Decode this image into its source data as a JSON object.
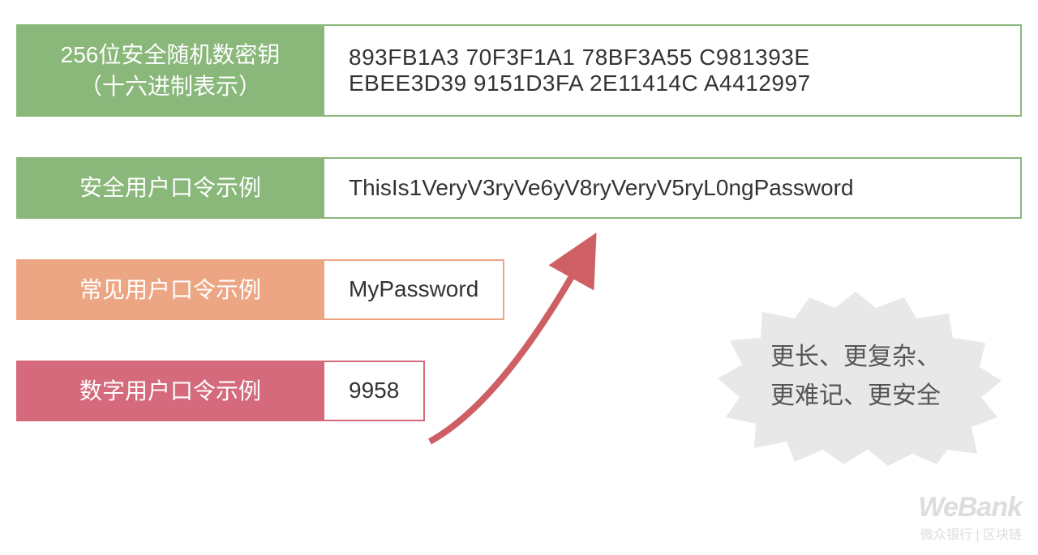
{
  "rows": [
    {
      "label_line1": "256位安全随机数密钥",
      "label_line2": "（十六进制表示）",
      "value_line1": "893FB1A3 70F3F1A1 78BF3A55 C981393E",
      "value_line2": "EBEE3D39 9151D3FA 2E11414C A4412997",
      "color": "green"
    },
    {
      "label": "安全用户口令示例",
      "value": "ThisIs1VeryV3ryVe6yV8ryVeryV5ryL0ngPassword",
      "color": "green"
    },
    {
      "label": "常见用户口令示例",
      "value": "MyPassword",
      "color": "orange"
    },
    {
      "label": "数字用户口令示例",
      "value": "9958",
      "color": "red"
    }
  ],
  "callout": {
    "line1": "更长、更复杂、",
    "line2": "更难记、更安全"
  },
  "watermark": {
    "brand": "WeBank",
    "sub": "微众银行 | 区块链"
  },
  "colors": {
    "green": "#89b87a",
    "orange": "#eda684",
    "red": "#d46a7c",
    "starburst": "#e8e8e8",
    "arrow": "#ce5f65"
  }
}
